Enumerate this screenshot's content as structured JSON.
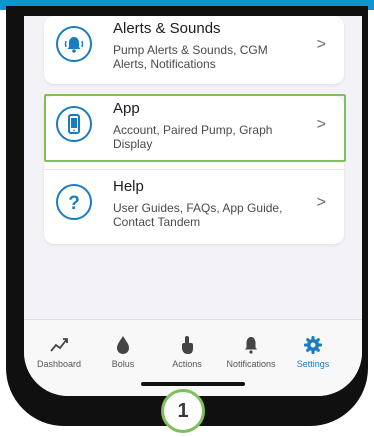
{
  "menu": {
    "items": [
      {
        "title": "Alerts & Sounds",
        "description": "Pump Alerts & Sounds, CGM Alerts, Notifications",
        "icon": "alert-bell-icon"
      },
      {
        "title": "App",
        "description": "Account, Paired Pump, Graph Display",
        "icon": "phone-icon"
      },
      {
        "title": "Help",
        "description": "User Guides, FAQs, App Guide, Contact Tandem",
        "icon": "help-question-icon"
      }
    ],
    "chevron": ">"
  },
  "tab_bar": {
    "tabs": [
      {
        "label": "Dashboard",
        "icon": "dashboard-trend-icon"
      },
      {
        "label": "Bolus",
        "icon": "bolus-drop-icon"
      },
      {
        "label": "Actions",
        "icon": "actions-hand-icon"
      },
      {
        "label": "Notifications",
        "icon": "notifications-bell-icon"
      },
      {
        "label": "Settings",
        "icon": "settings-gear-icon",
        "active": true
      }
    ]
  },
  "callout": {
    "step_number": "1"
  },
  "colors": {
    "accent": "#1a7cc0",
    "highlight": "#7fc05a",
    "top_strip": "#0d95cf"
  }
}
